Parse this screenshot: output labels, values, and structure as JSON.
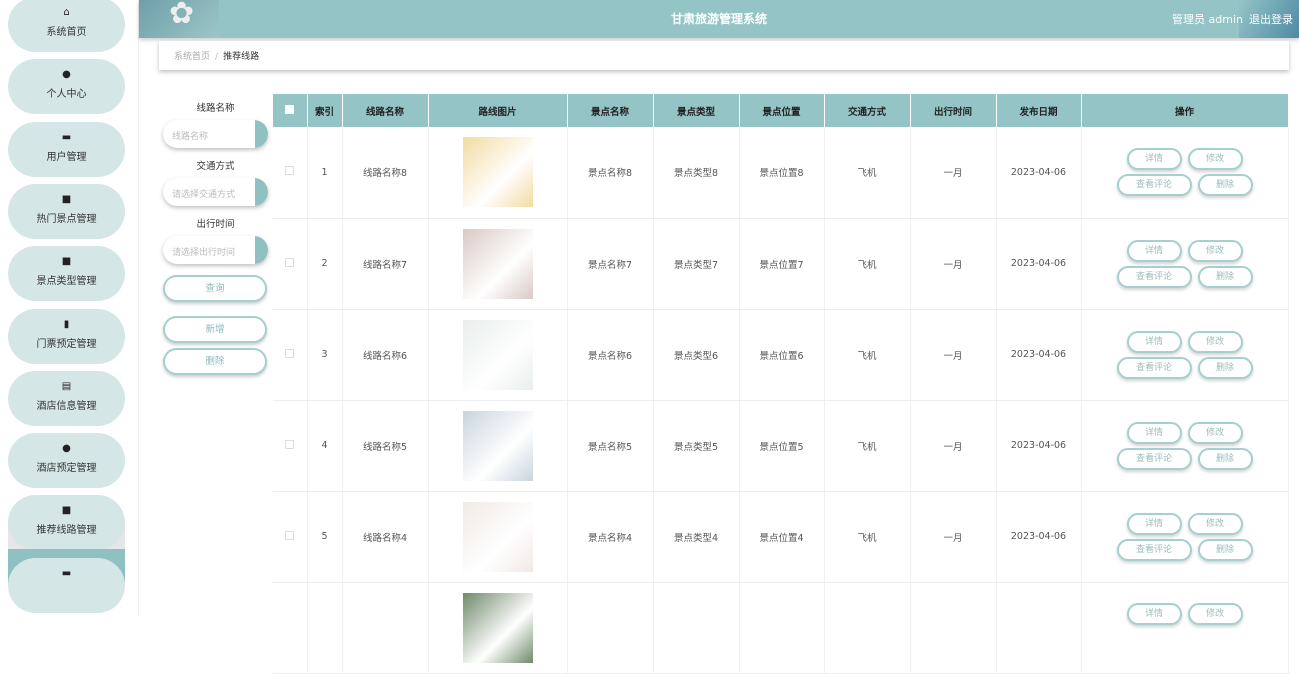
{
  "header": {
    "title": "甘肃旅游管理系统",
    "user": "管理员 admin",
    "logout": "退出登录"
  },
  "sidebar": {
    "items": [
      {
        "label": "系统首页",
        "icon": "home-icon",
        "glyph": "⌂"
      },
      {
        "label": "个人中心",
        "icon": "user-icon",
        "glyph": "●"
      },
      {
        "label": "用户管理",
        "icon": "briefcase-icon",
        "glyph": "▬"
      },
      {
        "label": "热门景点管理",
        "icon": "grid-icon",
        "glyph": "■"
      },
      {
        "label": "景点类型管理",
        "icon": "grid-icon",
        "glyph": "■"
      },
      {
        "label": "门票预定管理",
        "icon": "bar-chart-icon",
        "glyph": "▮"
      },
      {
        "label": "酒店信息管理",
        "icon": "clipboard-icon",
        "glyph": "▤"
      },
      {
        "label": "酒店预定管理",
        "icon": "map-pin-icon",
        "glyph": "●"
      },
      {
        "label": "推荐线路管理",
        "icon": "grid-icon",
        "glyph": "■"
      },
      {
        "label": "",
        "icon": "monitor-icon",
        "glyph": "▬"
      }
    ],
    "sub_item": "推荐线路"
  },
  "breadcrumb": {
    "home": "系统首页",
    "sep": "/",
    "current": "推荐线路"
  },
  "filters": {
    "name_label": "线路名称",
    "name_placeholder": "线路名称",
    "transport_label": "交通方式",
    "transport_placeholder": "请选择交通方式",
    "time_label": "出行时间",
    "time_placeholder": "请选择出行时间",
    "search": "查询",
    "add": "新增",
    "delete": "删除"
  },
  "table": {
    "headers": [
      "索引",
      "线路名称",
      "路线图片",
      "景点名称",
      "景点类型",
      "景点位置",
      "交通方式",
      "出行时间",
      "发布日期",
      "操作"
    ],
    "actions": {
      "detail": "详情",
      "edit": "修改",
      "comments": "查看评论",
      "delete": "删除"
    },
    "rows": [
      {
        "index": "1",
        "name": "线路名称8",
        "spot": "景点名称8",
        "type": "景点类型8",
        "loc": "景点位置8",
        "transport": "飞机",
        "time": "一月",
        "date": "2023-04-06",
        "img": "#f3dba0"
      },
      {
        "index": "2",
        "name": "线路名称7",
        "spot": "景点名称7",
        "type": "景点类型7",
        "loc": "景点位置7",
        "transport": "飞机",
        "time": "一月",
        "date": "2023-04-06",
        "img": "#d9c9c4"
      },
      {
        "index": "3",
        "name": "线路名称6",
        "spot": "景点名称6",
        "type": "景点类型6",
        "loc": "景点位置6",
        "transport": "飞机",
        "time": "一月",
        "date": "2023-04-06",
        "img": "#e8eeec"
      },
      {
        "index": "4",
        "name": "线路名称5",
        "spot": "景点名称5",
        "type": "景点类型5",
        "loc": "景点位置5",
        "transport": "飞机",
        "time": "一月",
        "date": "2023-04-06",
        "img": "#c9d4de"
      },
      {
        "index": "5",
        "name": "线路名称4",
        "spot": "景点名称4",
        "type": "景点类型4",
        "loc": "景点位置4",
        "transport": "飞机",
        "time": "一月",
        "date": "2023-04-06",
        "img": "#f1e9e6"
      },
      {
        "index": "",
        "name": "",
        "spot": "",
        "type": "",
        "loc": "",
        "transport": "",
        "time": "",
        "date": "",
        "img": "#6f8a6a"
      }
    ]
  }
}
